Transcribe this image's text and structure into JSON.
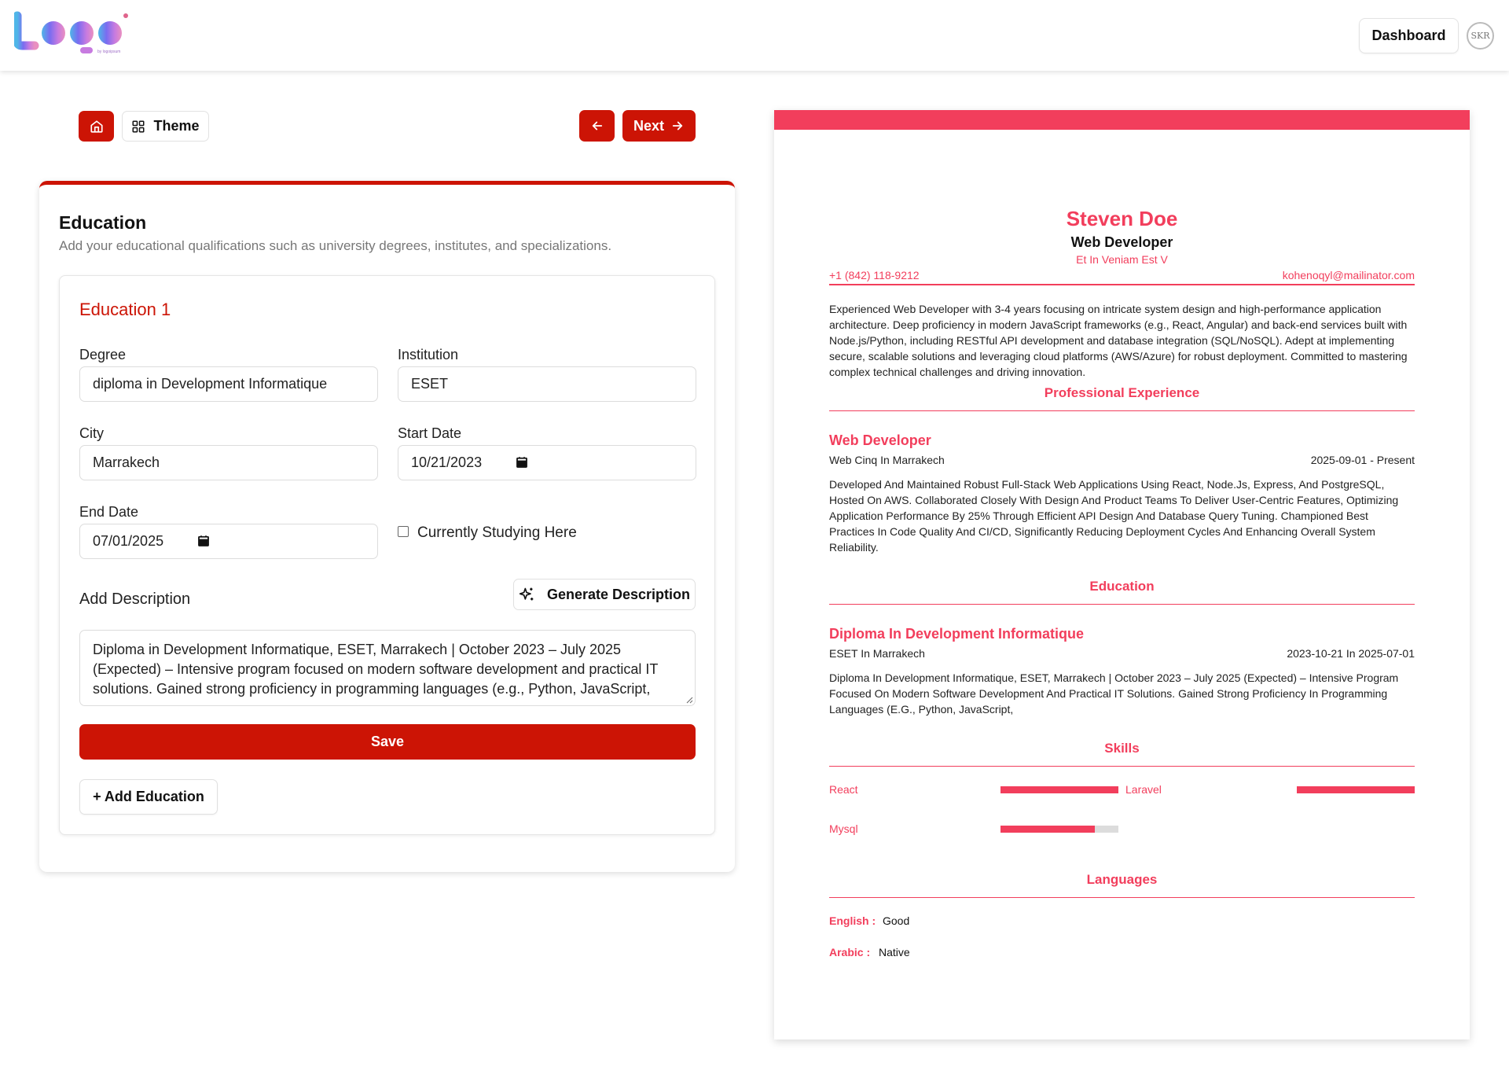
{
  "header": {
    "dashboard_label": "Dashboard",
    "avatar_initials": "SKR"
  },
  "toolbar": {
    "theme_label": "Theme",
    "next_label": "Next"
  },
  "form": {
    "title": "Education",
    "subtitle": "Add your educational qualifications such as university degrees, institutes, and specializations.",
    "entry_title": "Education 1",
    "degree_label": "Degree",
    "degree_value": "diploma in Development Informatique",
    "institution_label": "Institution",
    "institution_value": "ESET",
    "city_label": "City",
    "city_value": "Marrakech",
    "start_label": "Start Date",
    "start_value": "10/21/2023",
    "end_label": "End Date",
    "end_value": "07/01/2025",
    "currently_label": "Currently Studying Here",
    "currently_checked": false,
    "add_desc_label": "Add Description",
    "generate_label": "Generate Description",
    "description": "Diploma in Development Informatique, ESET, Marrakech | October 2023 – July 2025 (Expected) – Intensive program focused on modern software development and practical IT solutions. Gained strong proficiency in programming languages (e.g., Python, JavaScript,",
    "save_label": "Save",
    "add_education_label": "+ Add Education"
  },
  "resume": {
    "accent": "#f23e5c",
    "name": "Steven Doe",
    "job_title": "Web Developer",
    "address": "Et In Veniam Est V",
    "phone": "+1 (842) 118-9212",
    "email": "kohenoqyl@mailinator.com",
    "summary": "Experienced Web Developer with 3-4 years focusing on intricate system design and high-performance application architecture. Deep proficiency in modern JavaScript frameworks (e.g., React, Angular) and back-end services built with Node.js/Python, including RESTful API development and database integration (SQL/NoSQL). Adept at implementing secure, scalable solutions and leveraging cloud platforms (AWS/Azure) for robust deployment. Committed to mastering complex technical challenges and driving innovation.",
    "experience_heading": "Professional Experience",
    "experience": [
      {
        "title": "Web Developer",
        "company": "Web Cinq In Marrakech",
        "dates": "2025-09-01 - Present",
        "description": "Developed And Maintained Robust Full-Stack Web Applications Using React, Node.Js, Express, And PostgreSQL, Hosted On AWS. Collaborated Closely With Design And Product Teams To Deliver User-Centric Features, Optimizing Application Performance By 25% Through Efficient API Design And Database Query Tuning. Championed Best Practices In Code Quality And CI/CD, Significantly Reducing Deployment Cycles And Enhancing Overall System Reliability."
      }
    ],
    "education_heading": "Education",
    "education": [
      {
        "title": "Diploma In Development Informatique",
        "institution": "ESET In Marrakech",
        "dates": "2023-10-21 In 2025-07-01",
        "description": "Diploma In Development Informatique, ESET, Marrakech | October 2023 – July 2025 (Expected) – Intensive Program Focused On Modern Software Development And Practical IT Solutions. Gained Strong Proficiency In Programming Languages (E.G., Python, JavaScript,"
      }
    ],
    "skills_heading": "Skills",
    "skills": [
      {
        "name": "React",
        "level": 1.0
      },
      {
        "name": "Laravel",
        "level": 1.0
      },
      {
        "name": "Mysql",
        "level": 0.8
      }
    ],
    "languages_heading": "Languages",
    "languages": [
      {
        "name": "English :",
        "level": "Good"
      },
      {
        "name": "Arabic :",
        "level": "Native"
      }
    ]
  }
}
